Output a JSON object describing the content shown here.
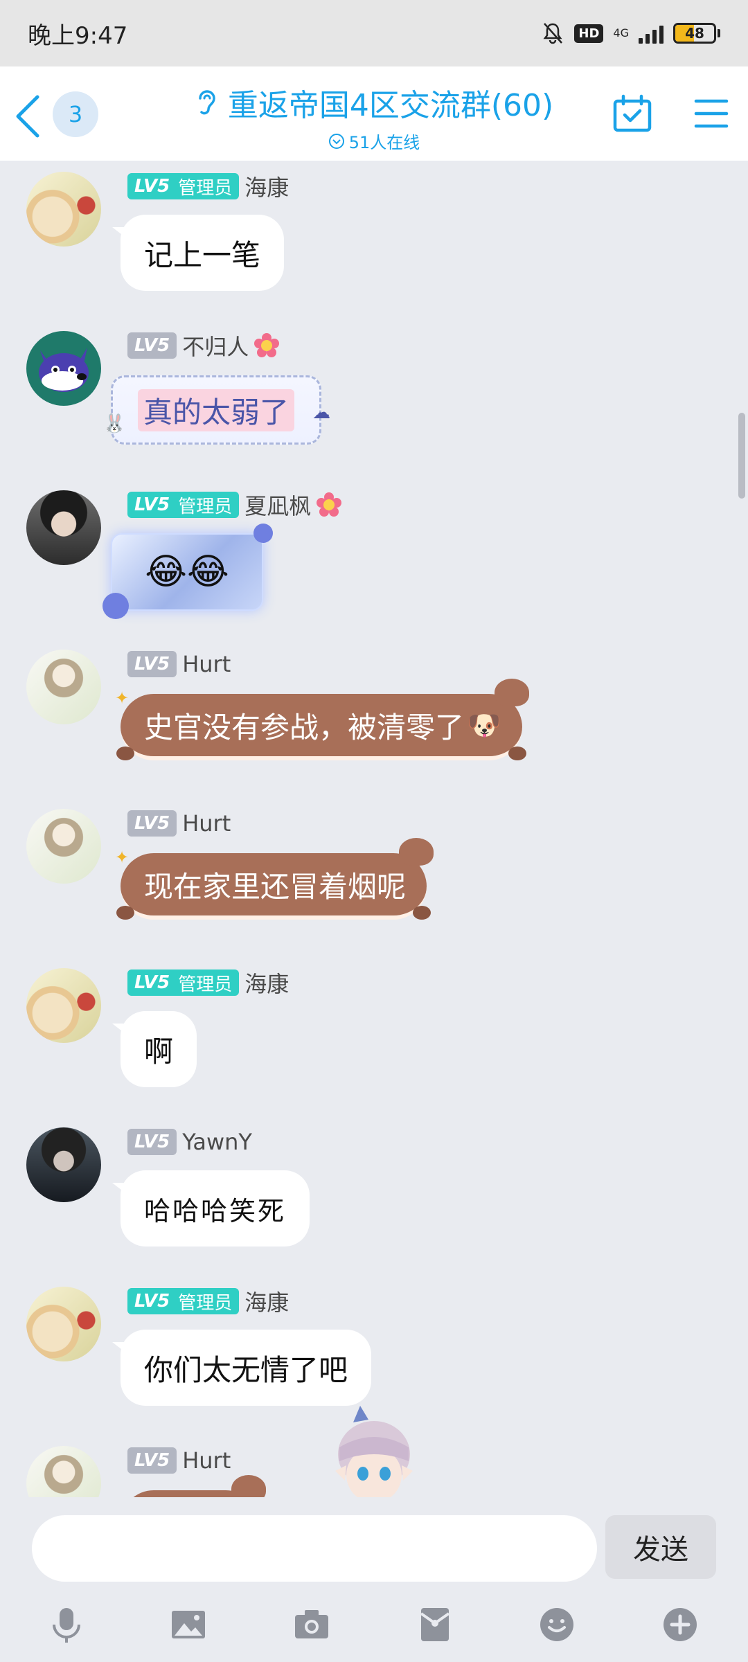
{
  "status_bar": {
    "time": "晚上9:47",
    "hd": "HD",
    "network": "4G",
    "battery": "48",
    "battery_level": 0.48
  },
  "header": {
    "back_label": "<",
    "unread_count": "3",
    "group_title": "重返帝国4区交流群(60)",
    "online_text": "51人在线"
  },
  "messages": [
    {
      "avatar": "cat-avatar",
      "level": "LV5",
      "role": "管理员",
      "sender": "海康",
      "text": "记上一笔",
      "bubble": "plain"
    },
    {
      "avatar": "dog-avatar",
      "level": "LV5",
      "role": "",
      "sender": "不归人",
      "has_flower": true,
      "text": "真的太弱了",
      "bubble": "lace"
    },
    {
      "avatar": "boy-avatar",
      "level": "LV5",
      "role": "管理员",
      "sender": "夏凪枫",
      "has_flower": true,
      "text": "😂😂",
      "bubble": "ice"
    },
    {
      "avatar": "girl-avatar",
      "level": "LV5",
      "role": "",
      "sender": "Hurt",
      "text": "史官没有参战，被清零了",
      "emoji": "🐶",
      "bubble": "bear"
    },
    {
      "avatar": "girl-avatar",
      "level": "LV5",
      "role": "",
      "sender": "Hurt",
      "text": "现在家里还冒着烟呢",
      "bubble": "bear"
    },
    {
      "avatar": "cat-avatar",
      "level": "LV5",
      "role": "管理员",
      "sender": "海康",
      "text": "啊",
      "bubble": "plain"
    },
    {
      "avatar": "yawn-avatar",
      "level": "LV5",
      "role": "",
      "sender": "YawnY",
      "text": "哈哈哈笑死",
      "bubble": "handwriting"
    },
    {
      "avatar": "cat-avatar",
      "level": "LV5",
      "role": "管理员",
      "sender": "海康",
      "text": "你们太无情了吧",
      "bubble": "plain"
    },
    {
      "avatar": "girl-avatar",
      "level": "LV5",
      "role": "",
      "sender": "Hurt",
      "text": "",
      "bubble": "bear-partial"
    }
  ],
  "input": {
    "placeholder": "",
    "send_label": "发送"
  },
  "toolbar": {
    "items": [
      "microphone-icon",
      "image-icon",
      "camera-icon",
      "red-packet-icon",
      "emoji-icon",
      "plus-icon"
    ]
  },
  "colors": {
    "accent": "#1aa2e8",
    "admin_badge": "#2fcfc4",
    "level_badge": "#b2b6c2",
    "bear_bubble": "#a86f58",
    "chat_bg": "#e9ebf0"
  }
}
